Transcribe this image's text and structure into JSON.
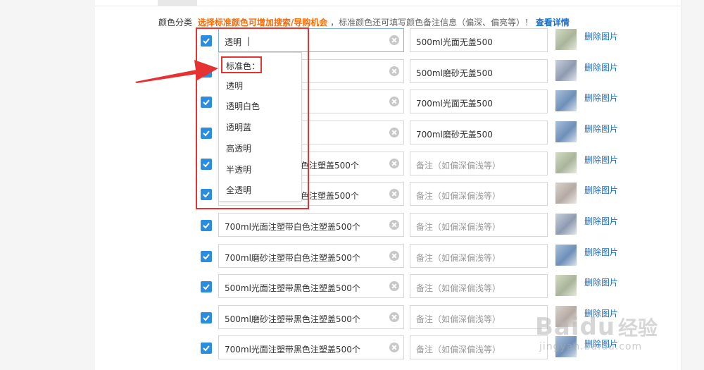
{
  "section_label": "颜色分类",
  "hint_text": "选择标准颜色可增加搜索/导购机会",
  "note_text": "，标准颜色还可填写颜色备注信息（偏深、偏亮等）！",
  "detail_link": "查看详情",
  "current_input": "透明",
  "delete_label": "删除图片",
  "note_placeholder": "备注（如偏深偏浅等）",
  "rows": [
    {
      "name": "透明",
      "note": "500ml光面无盖500",
      "checked": true
    },
    {
      "name": "",
      "note": "500ml磨砂无盖500",
      "checked": true
    },
    {
      "name": "",
      "note": "700ml光面无盖500",
      "checked": true
    },
    {
      "name": "",
      "note": "700ml磨砂无盖500",
      "checked": true
    },
    {
      "name": "色注塑盖500个",
      "note": "",
      "checked": true
    },
    {
      "name": "色注塑盖500个",
      "note": "",
      "checked": true
    },
    {
      "name": "700ml光面注塑带白色注塑盖500个",
      "note": "",
      "checked": true
    },
    {
      "name": "700ml磨砂注塑带白色注塑盖500个",
      "note": "",
      "checked": true
    },
    {
      "name": "500ml光面注塑带黑色注塑盖500个",
      "note": "",
      "checked": true
    },
    {
      "name": "500ml磨砂注塑带黑色注塑盖500个",
      "note": "",
      "checked": true
    },
    {
      "name": "700ml光面注塑带黑色注塑盖500个",
      "note": "",
      "checked": true
    }
  ],
  "dropdown": {
    "header": "标准色：",
    "options": [
      "透明",
      "透明白色",
      "透明蓝",
      "高透明",
      "半透明",
      "全透明"
    ]
  },
  "watermark": {
    "brand": "Baidu",
    "cn": "经验",
    "url": "jingyan.baidu.com"
  },
  "colors": {
    "accent": "#2a8de0",
    "hint": "#ff6a00",
    "link": "#1a6fc4",
    "highlight": "#e53333"
  }
}
